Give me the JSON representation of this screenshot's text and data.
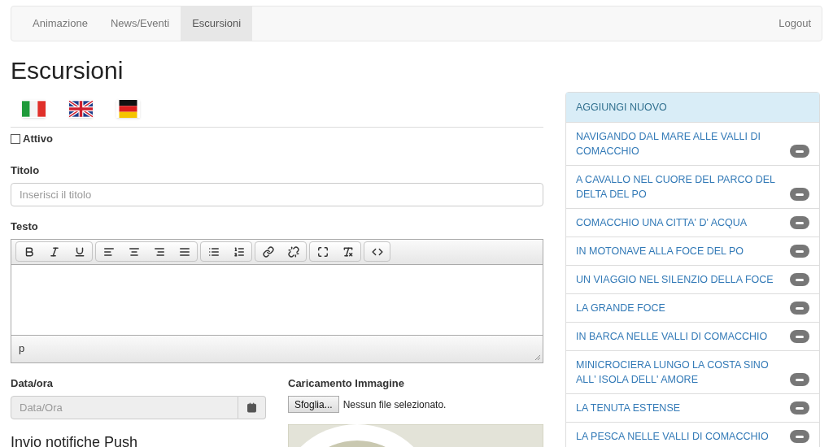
{
  "nav": {
    "tabs": [
      {
        "label": "Animazione",
        "selected": false
      },
      {
        "label": "News/Eventi",
        "selected": false
      },
      {
        "label": "Escursioni",
        "selected": true
      }
    ],
    "logout": "Logout"
  },
  "page_title": "Escursioni",
  "languages": [
    {
      "kind": "it"
    },
    {
      "kind": "en"
    },
    {
      "kind": "de"
    }
  ],
  "active": {
    "label": "Attivo",
    "checked": false
  },
  "title_field": {
    "label": "Titolo",
    "placeholder": "Inserisci il titolo"
  },
  "editor": {
    "label": "Testo",
    "status": "p"
  },
  "date_field": {
    "label": "Data/ora",
    "placeholder": "Data/Ora"
  },
  "push_heading": "Invio notifiche Push",
  "image_upload": {
    "label": "Caricamento Immagine",
    "button": "Sfoglia...",
    "status": "Nessun file selezionato."
  },
  "list": {
    "header": "AGGIUNGI NUOVO",
    "items": [
      {
        "title": "NAVIGANDO DAL MARE ALLE VALLI DI COMACCHIO"
      },
      {
        "title": "A CAVALLO NEL CUORE DEL PARCO DEL DELTA DEL PO"
      },
      {
        "title": "COMACCHIO UNA CITTA' D' ACQUA"
      },
      {
        "title": "IN MOTONAVE ALLA FOCE DEL PO"
      },
      {
        "title": "UN VIAGGIO NEL SILENZIO DELLA FOCE"
      },
      {
        "title": "LA GRANDE FOCE"
      },
      {
        "title": "IN BARCA NELLE VALLI DI COMACCHIO"
      },
      {
        "title": "MINICROCIERA LUNGO LA COSTA SINO ALL' ISOLA DELL' AMORE"
      },
      {
        "title": "LA TENUTA ESTENSE"
      },
      {
        "title": "LA PESCA NELLE VALLI DI COMACCHIO"
      }
    ]
  }
}
